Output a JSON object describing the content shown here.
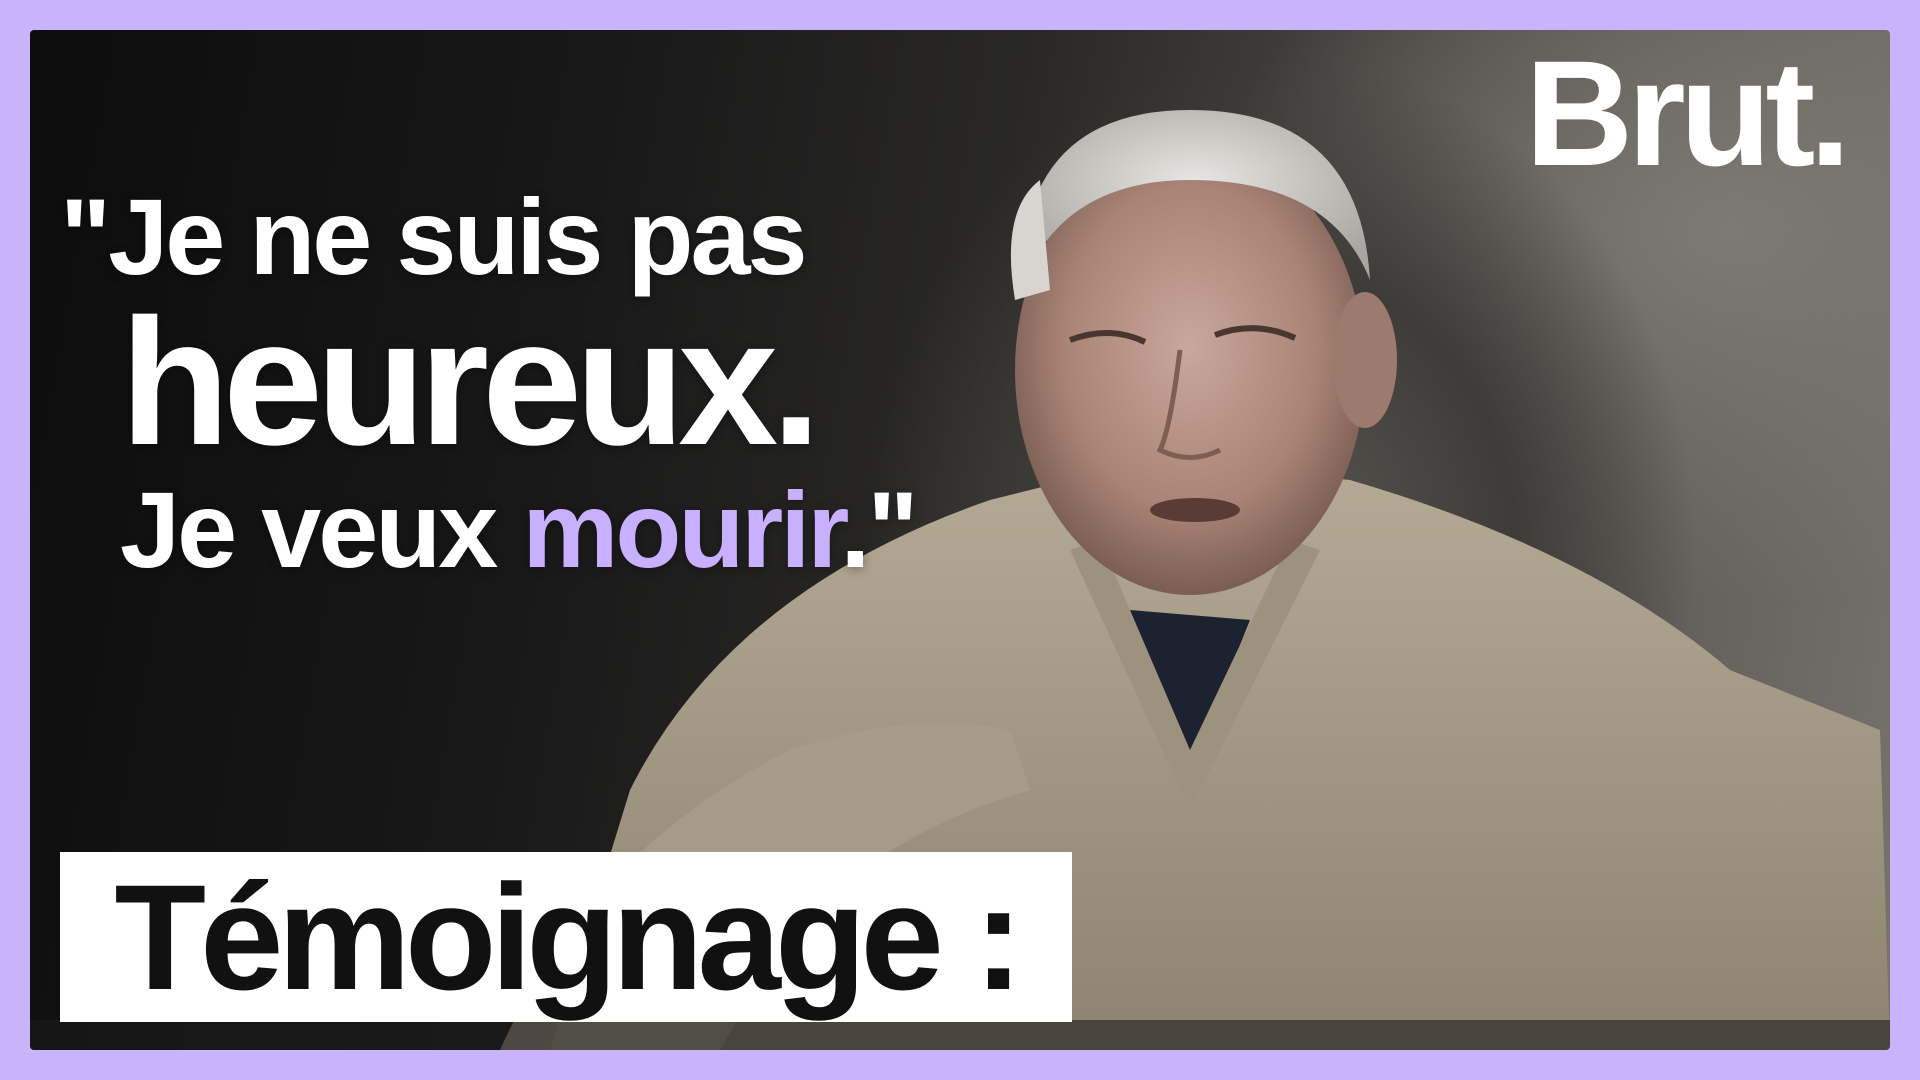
{
  "brand": {
    "logo_text": "Brut."
  },
  "quote": {
    "line1": "\"Je ne suis pas",
    "line2": "heureux.",
    "line3_part1": "Je veux ",
    "line3_highlight": "mourir",
    "line3_part2": ".\""
  },
  "label": {
    "text": "Témoignage :"
  },
  "colors": {
    "frame_border": "#c9b3fb",
    "accent": "#c9b0ff",
    "text": "#ffffff",
    "label_bg": "#ffffff",
    "label_text": "#111111"
  }
}
